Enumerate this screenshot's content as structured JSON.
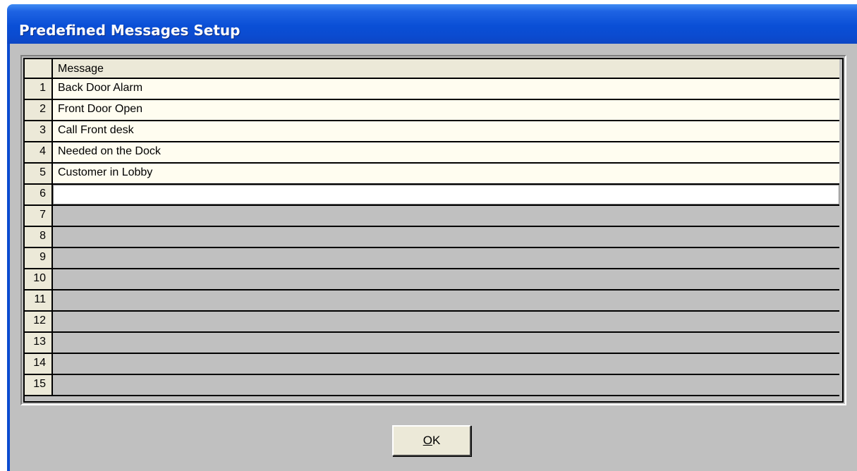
{
  "window": {
    "title": "Predefined Messages Setup"
  },
  "grid": {
    "column_header": "Message",
    "rows": [
      {
        "num": "1",
        "message": "Back Door Alarm"
      },
      {
        "num": "2",
        "message": "Front Door Open"
      },
      {
        "num": "3",
        "message": "Call Front desk"
      },
      {
        "num": "4",
        "message": "Needed on the Dock"
      },
      {
        "num": "5",
        "message": "Customer in Lobby"
      },
      {
        "num": "6",
        "message": ""
      },
      {
        "num": "7",
        "message": ""
      },
      {
        "num": "8",
        "message": ""
      },
      {
        "num": "9",
        "message": ""
      },
      {
        "num": "10",
        "message": ""
      },
      {
        "num": "11",
        "message": ""
      },
      {
        "num": "12",
        "message": ""
      },
      {
        "num": "13",
        "message": ""
      },
      {
        "num": "14",
        "message": ""
      },
      {
        "num": "15",
        "message": ""
      }
    ]
  },
  "buttons": {
    "ok_mnemonic": "O",
    "ok_rest": "K"
  },
  "colors": {
    "title_bar": "#0b4bd0",
    "client_bg": "#c0c0c0",
    "filled_cell_bg": "#fffdf0",
    "header_bg": "#ece9d8"
  }
}
